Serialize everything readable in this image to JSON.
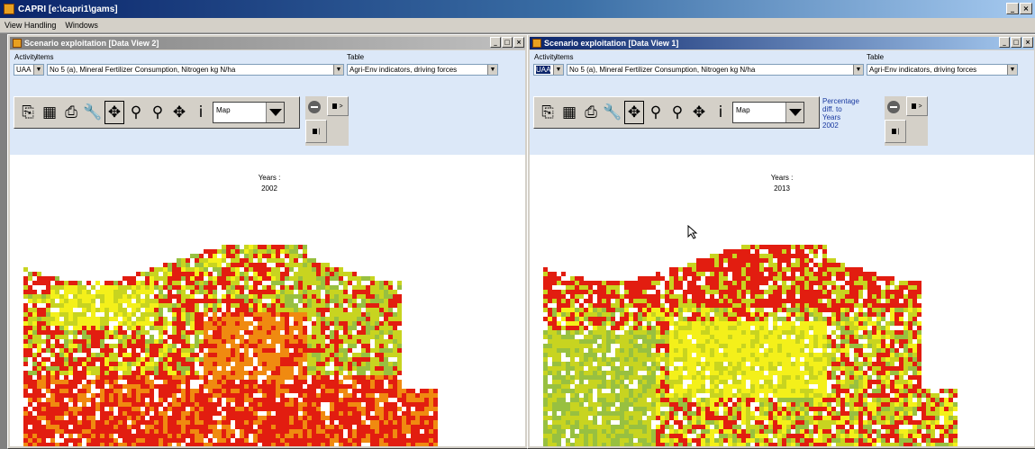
{
  "app": {
    "title": "CAPRI [e:\\capri1\\gams]",
    "controls": [
      "_",
      "×"
    ]
  },
  "menu": [
    "View Handling",
    "Windows"
  ],
  "views": [
    {
      "title": "Scenario exploitation [Data View 2]",
      "activity_label": "Activity",
      "items_label": "Items",
      "table_label": "Table",
      "activity_value": "UAA",
      "items_value": "No 5 (a), Mineral Fertilizer Consumption, Nitrogen kg N/ha",
      "table_value": "Agri-Env indicators, driving forces",
      "map_type": "Map",
      "map_caption_line1": "Years :",
      "map_caption_line2": "2002",
      "percentage_note": ""
    },
    {
      "title": "Scenario exploitation [Data View 1]",
      "activity_label": "Activity",
      "items_label": "Items",
      "table_label": "Table",
      "activity_value": "UAA",
      "items_value": "No 5 (a), Mineral Fertilizer Consumption, Nitrogen kg N/ha",
      "table_value": "Agri-Env indicators, driving forces",
      "map_type": "Map",
      "map_caption_line1": "Years :",
      "map_caption_line2": "2013",
      "percentage_note": [
        "Percentage diff. to",
        "Years",
        "2002"
      ]
    }
  ],
  "colors": {
    "red": "#e21d10",
    "orange": "#f08a10",
    "yellow": "#f4f01a",
    "yellowgreen": "#c8d420",
    "lightgreen": "#98c040",
    "green": "#3a9a10"
  }
}
